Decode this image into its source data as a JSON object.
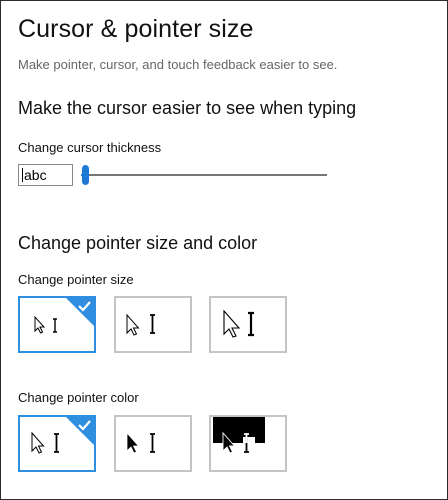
{
  "page": {
    "title": "Cursor & pointer size",
    "subtitle": "Make pointer, cursor, and touch feedback easier to see."
  },
  "cursor_section": {
    "title": "Make the cursor easier to see when typing",
    "thickness_label": "Change cursor thickness",
    "preview_text": "abc",
    "thickness_value": 1,
    "thickness_min": 1,
    "thickness_max": 20
  },
  "pointer_section": {
    "title": "Change pointer size and color",
    "size_label": "Change pointer size",
    "size_options": [
      {
        "id": "small",
        "selected": true
      },
      {
        "id": "medium",
        "selected": false
      },
      {
        "id": "large",
        "selected": false
      }
    ],
    "color_label": "Change pointer color",
    "color_options": [
      {
        "id": "white",
        "selected": true
      },
      {
        "id": "black",
        "selected": false
      },
      {
        "id": "inverted",
        "selected": false
      }
    ]
  },
  "colors": {
    "accent": "#2f8ee0",
    "slider_accent": "#1e7ad4",
    "unselected_border": "#c4c4c4"
  }
}
